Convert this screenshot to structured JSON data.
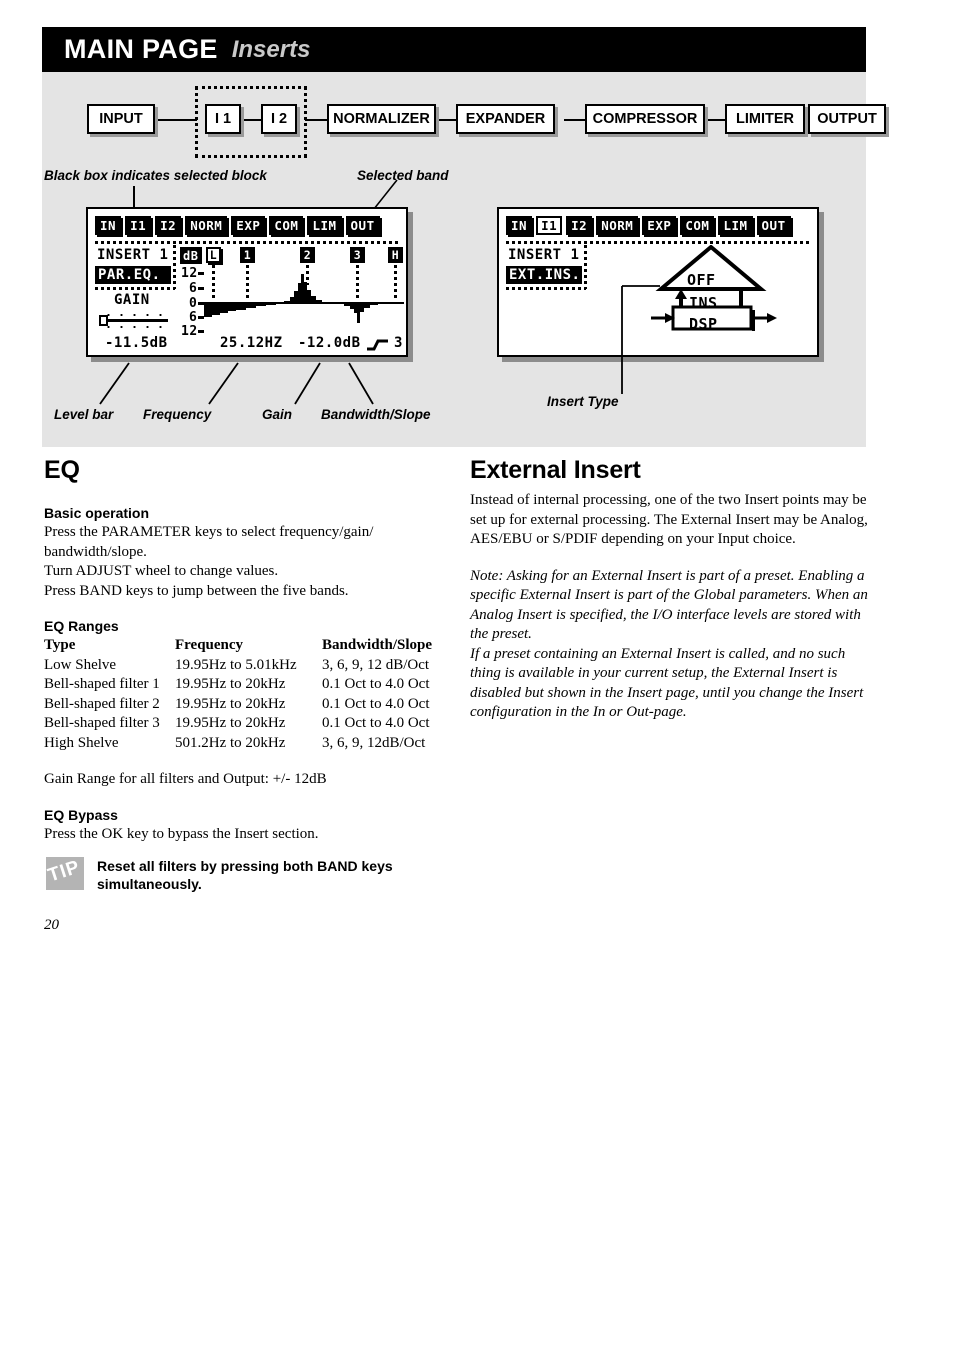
{
  "header": {
    "title": "MAIN PAGE",
    "subtitle": "Inserts"
  },
  "signal_flow": {
    "blocks": [
      {
        "label": "INPUT"
      },
      {
        "label": "I 1"
      },
      {
        "label": "I 2"
      },
      {
        "label": "NORMALIZER"
      },
      {
        "label": "EXPANDER"
      },
      {
        "label": "COMPRESSOR"
      },
      {
        "label": "LIMITER"
      },
      {
        "label": "OUTPUT"
      }
    ]
  },
  "annotations": {
    "black_box": "Black box indicates selected block",
    "selected_band": "Selected band",
    "level_bar": "Level bar",
    "frequency": "Frequency",
    "gain": "Gain",
    "bandwidth_slope": "Bandwidth/Slope",
    "insert_type": "Insert Type"
  },
  "lcd_left": {
    "menu": [
      {
        "label": "IN",
        "selected": false
      },
      {
        "label": "I1",
        "selected": true
      },
      {
        "label": "I2",
        "selected": false
      },
      {
        "label": "NORM",
        "selected": false
      },
      {
        "label": "EXP",
        "selected": false
      },
      {
        "label": "COM",
        "selected": false
      },
      {
        "label": "LIM",
        "selected": false
      },
      {
        "label": "OUT",
        "selected": false
      }
    ],
    "insert_label": "INSERT 1",
    "mode": "PAR.EQ.",
    "param_label": "GAIN",
    "level_value": "-11.5dB",
    "db_axis_label": "dB",
    "db_ticks": [
      "12",
      "6",
      "0",
      "6",
      "12"
    ],
    "band_markers": [
      "L",
      "1",
      "2",
      "3",
      "H"
    ],
    "selected_band_marker": "L",
    "freq_value": "25.12HZ",
    "gain_value": "-12.0dB",
    "slope_value": "3"
  },
  "lcd_right": {
    "menu": [
      {
        "label": "IN",
        "selected": false
      },
      {
        "label": "I1",
        "selected": false
      },
      {
        "label": "I2",
        "selected": false
      },
      {
        "label": "NORM",
        "selected": false
      },
      {
        "label": "EXP",
        "selected": false
      },
      {
        "label": "COM",
        "selected": false
      },
      {
        "label": "LIM",
        "selected": false
      },
      {
        "label": "OUT",
        "selected": false
      }
    ],
    "insert_label": "INSERT 1",
    "mode": "EXT.INS.",
    "routing": {
      "off": "OFF",
      "ins": "INS",
      "dsp": "DSP"
    }
  },
  "left_column": {
    "heading": "EQ",
    "basic_operation": {
      "heading": "Basic operation",
      "lines": [
        "Press the PARAMETER keys to select frequency/gain/",
        "bandwidth/slope.",
        "Turn ADJUST wheel to change values.",
        "Press BAND keys to jump between the five bands."
      ]
    },
    "eq_ranges": {
      "heading": "EQ Ranges",
      "columns": [
        "Type",
        "Frequency",
        "Bandwidth/Slope"
      ],
      "rows": [
        [
          "Low Shelve",
          "19.95Hz to 5.01kHz",
          "3, 6, 9, 12 dB/Oct"
        ],
        [
          "Bell-shaped filter 1",
          "19.95Hz to 20kHz",
          "0.1 Oct to 4.0 Oct"
        ],
        [
          "Bell-shaped filter 2",
          "19.95Hz to 20kHz",
          "0.1 Oct to 4.0 Oct"
        ],
        [
          "Bell-shaped filter 3",
          "19.95Hz to 20kHz",
          "0.1 Oct to 4.0 Oct"
        ],
        [
          "High Shelve",
          "501.2Hz to 20kHz",
          "3, 6, 9, 12dB/Oct"
        ]
      ]
    },
    "gain_range_note": "Gain Range for all filters and Output: +/- 12dB",
    "eq_bypass": {
      "heading": "EQ Bypass",
      "text": "Press the OK key to bypass the Insert section."
    }
  },
  "right_column": {
    "heading": "External Insert",
    "intro_lines": [
      "Instead of internal processing, one of the two Insert points may be",
      "set up for external processing. The External Insert may be Analog,",
      "AES/EBU or S/PDIF depending on your Input choice."
    ],
    "note_lines": [
      "Note: Asking for an External Insert is part of a preset. Enabling a",
      "specific External Insert is part of the Global parameters. When an",
      "Analog Insert is specified, the I/O interface levels are stored with",
      "the preset.",
      "If a preset containing an External Insert is called, and no such",
      "thing is available in your current setup, the External Insert is",
      "disabled but shown in the Insert page, until you change the Insert",
      "configuration in the In or Out-page."
    ]
  },
  "tip": {
    "icon_label": "TIP",
    "text": "Reset all filters by pressing both BAND keys simultaneously."
  },
  "page_number": "20"
}
